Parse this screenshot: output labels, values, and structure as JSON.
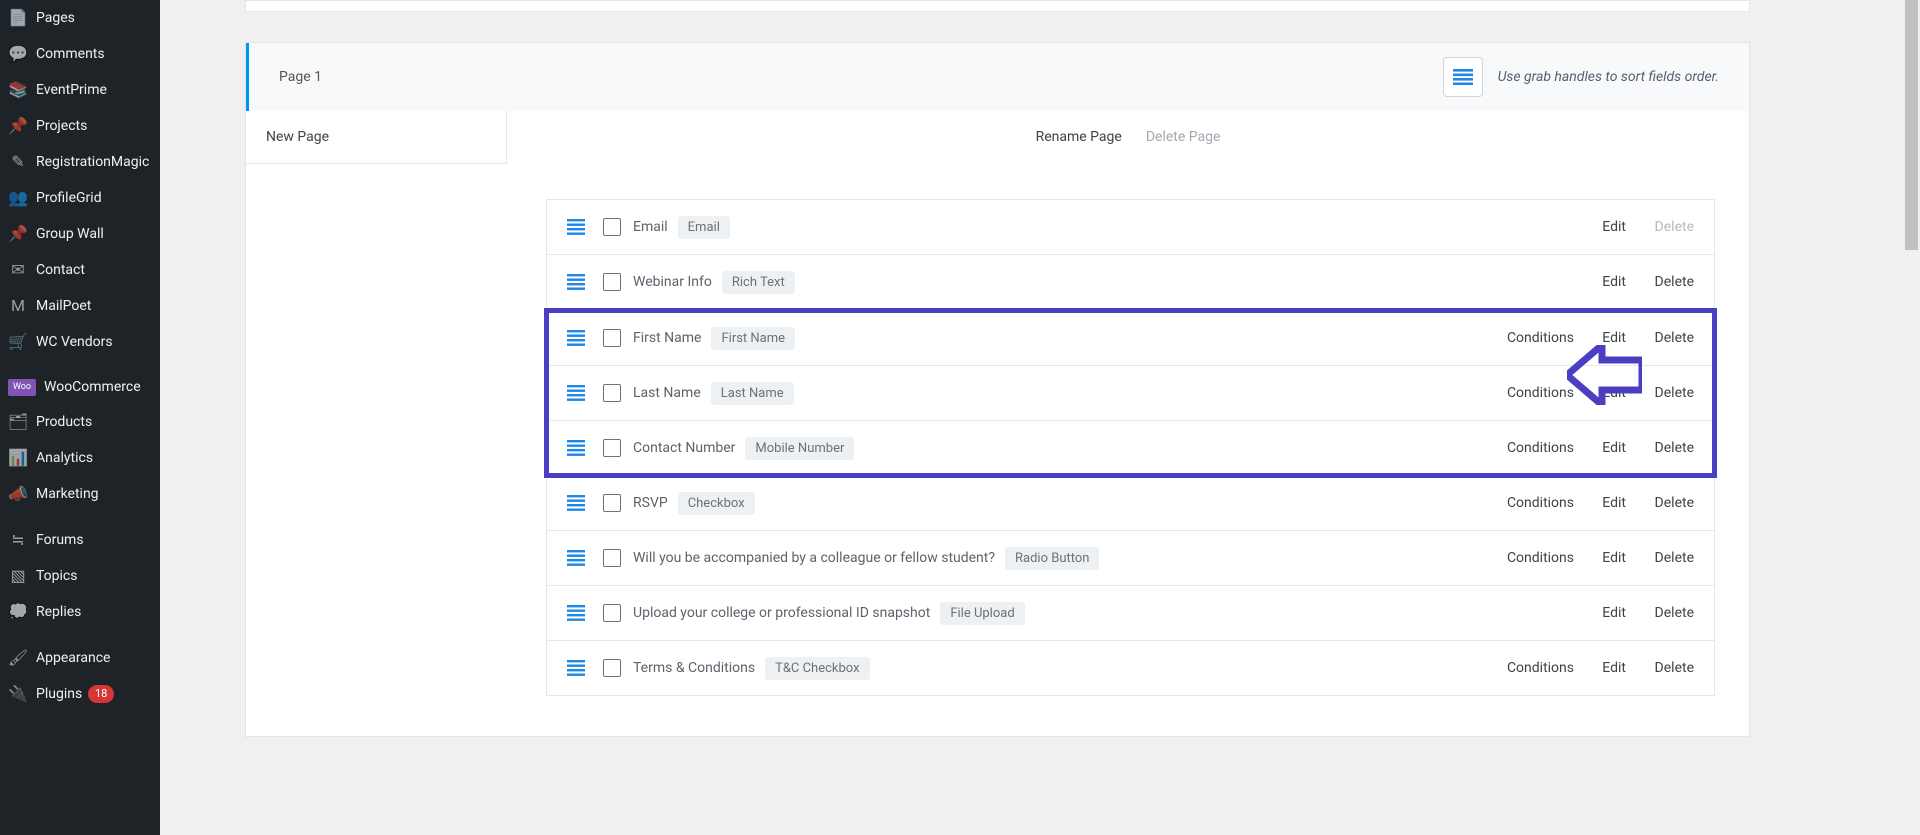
{
  "sidebar": {
    "items": [
      {
        "label": "Pages",
        "icon": "pages-icon"
      },
      {
        "label": "Comments",
        "icon": "comments-icon"
      },
      {
        "label": "EventPrime",
        "icon": "eventprime-icon"
      },
      {
        "label": "Projects",
        "icon": "projects-icon"
      },
      {
        "label": "RegistrationMagic",
        "icon": "regmagic-icon"
      },
      {
        "label": "ProfileGrid",
        "icon": "profilegrid-icon"
      },
      {
        "label": "Group Wall",
        "icon": "groupwall-icon"
      },
      {
        "label": "Contact",
        "icon": "contact-icon"
      },
      {
        "label": "MailPoet",
        "icon": "mailpoet-icon"
      },
      {
        "label": "WC Vendors",
        "icon": "wcvendors-icon"
      },
      {
        "label": "WooCommerce",
        "icon": "woocommerce-icon",
        "woo": true
      },
      {
        "label": "Products",
        "icon": "products-icon"
      },
      {
        "label": "Analytics",
        "icon": "analytics-icon"
      },
      {
        "label": "Marketing",
        "icon": "marketing-icon"
      },
      {
        "label": "Forums",
        "icon": "forums-icon"
      },
      {
        "label": "Topics",
        "icon": "topics-icon"
      },
      {
        "label": "Replies",
        "icon": "replies-icon"
      },
      {
        "label": "Appearance",
        "icon": "appearance-icon"
      },
      {
        "label": "Plugins",
        "icon": "plugins-icon",
        "badge": "18"
      }
    ]
  },
  "panel": {
    "title": "Page 1",
    "hint": "Use grab handles to sort fields order.",
    "newpage_label": "New Page",
    "rename_label": "Rename Page",
    "delete_label": "Delete Page"
  },
  "row_actions": {
    "conditions": "Conditions",
    "edit": "Edit",
    "delete": "Delete"
  },
  "fields": [
    {
      "label": "Email",
      "type": "Email",
      "conditions": false,
      "delete_enabled": false,
      "highlight": false
    },
    {
      "label": "Webinar Info",
      "type": "Rich Text",
      "conditions": false,
      "delete_enabled": true,
      "highlight": false
    },
    {
      "label": "First Name",
      "type": "First Name",
      "conditions": true,
      "delete_enabled": true,
      "highlight": true
    },
    {
      "label": "Last Name",
      "type": "Last Name",
      "conditions": true,
      "delete_enabled": true,
      "highlight": true
    },
    {
      "label": "Contact Number",
      "type": "Mobile Number",
      "conditions": true,
      "delete_enabled": true,
      "highlight": true
    },
    {
      "label": "RSVP",
      "type": "Checkbox",
      "conditions": true,
      "delete_enabled": true,
      "highlight": false
    },
    {
      "label": "Will you be accompanied by a colleague or fellow student?",
      "type": "Radio Button",
      "conditions": true,
      "delete_enabled": true,
      "highlight": false
    },
    {
      "label": "Upload your college or professional ID snapshot",
      "type": "File Upload",
      "conditions": false,
      "delete_enabled": true,
      "highlight": false
    },
    {
      "label": "Terms & Conditions",
      "type": "T&C Checkbox",
      "conditions": true,
      "delete_enabled": true,
      "highlight": false
    }
  ]
}
